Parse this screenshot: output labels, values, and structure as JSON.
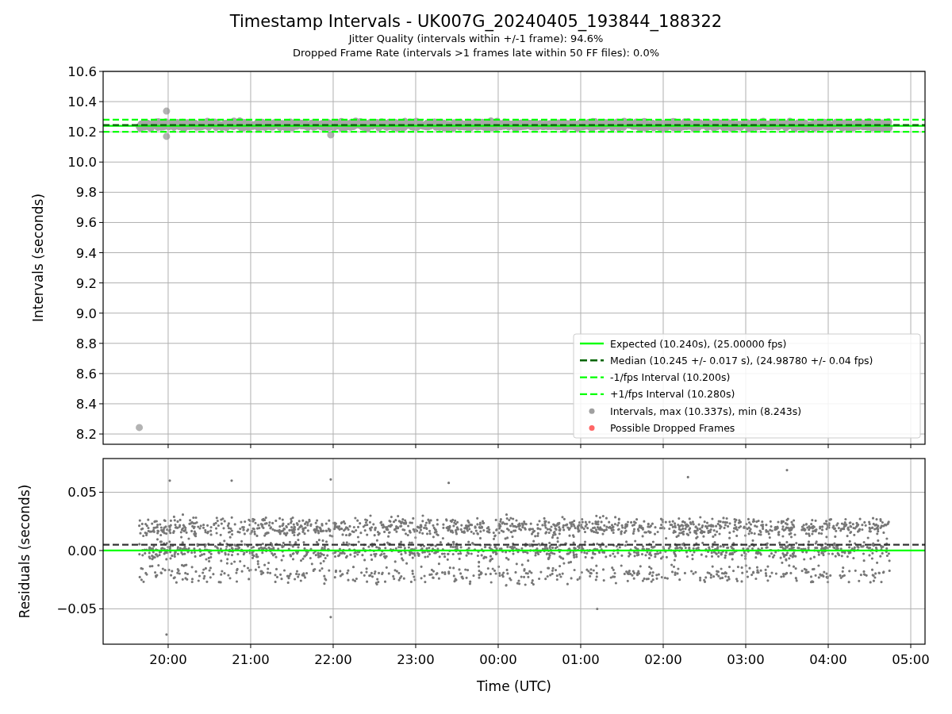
{
  "figure": {
    "title": "Timestamp Intervals - UK007G_20240405_193844_188322",
    "subtitles": [
      "Jitter Quality (intervals within +/-1 frame): 94.6%",
      "Dropped Frame Rate (intervals >1 frames late within 50 FF files): 0.0%"
    ]
  },
  "panels": [
    {
      "legend": [
        {
          "label": "Expected (10.240s), (25.00000 fps)",
          "color": "#00ff00",
          "kind": "line"
        },
        {
          "label": "Median (10.245 +/- 0.017 s), (24.98780 +/- 0.04 fps)",
          "color": "#006400",
          "kind": "dashed"
        },
        {
          "label": "-1/fps Interval (10.200s)",
          "color": "#00ff00",
          "kind": "dashed"
        },
        {
          "label": "+1/fps Interval (10.280s)",
          "color": "#00ff00",
          "kind": "dashed"
        },
        {
          "label": "Intervals, max (10.337s), min (8.243s)",
          "color": "#a0a0a0",
          "kind": "dot"
        },
        {
          "label": "Possible Dropped Frames",
          "color": "#ff6666",
          "kind": "dot"
        }
      ],
      "chart_data": {
        "type": "scatter",
        "ylabel": "Intervals (seconds)",
        "grid": true,
        "xlim": [
          "2024-04-05T19:12:43",
          "2024-04-06T05:10:23"
        ],
        "ylim": [
          8.132,
          10.6
        ],
        "yticks": [
          {
            "value": 8.2,
            "label": "8.2"
          },
          {
            "value": 8.4,
            "label": "8.4"
          },
          {
            "value": 8.6,
            "label": "8.6"
          },
          {
            "value": 8.8,
            "label": "8.8"
          },
          {
            "value": 9.0,
            "label": "9.0"
          },
          {
            "value": 9.2,
            "label": "9.2"
          },
          {
            "value": 9.4,
            "label": "9.4"
          },
          {
            "value": 9.6,
            "label": "9.6"
          },
          {
            "value": 9.8,
            "label": "9.8"
          },
          {
            "value": 10.0,
            "label": "10.0"
          },
          {
            "value": 10.2,
            "label": "10.2"
          },
          {
            "value": 10.4,
            "label": "10.4"
          },
          {
            "value": 10.6,
            "label": "10.6"
          }
        ],
        "ref_lines": [
          {
            "axis": "y",
            "value": 10.24,
            "color": "#00ff00",
            "line_style": "solid"
          },
          {
            "axis": "y",
            "value": 10.245,
            "color": "#006400",
            "line_style": "dashed"
          },
          {
            "axis": "y",
            "value": 10.2,
            "color": "#00ff00",
            "line_style": "dashed"
          },
          {
            "axis": "y",
            "value": 10.28,
            "color": "#00ff00",
            "line_style": "dashed"
          }
        ],
        "series": [
          {
            "color": "#808080",
            "x": [
              "2024-04-05T19:39:00",
              "2024-04-05T19:58:48",
              "2024-04-05T19:58:48",
              "2024-04-05T21:58:12"
            ],
            "values": [
              8.243,
              10.337,
              10.17,
              10.18
            ]
          }
        ]
      }
    },
    {
      "chart_data": {
        "type": "scatter",
        "ylabel": "Residuals (seconds)",
        "xlabel": "Time (UTC)",
        "grid": true,
        "xlim": [
          "2024-04-05T19:12:43",
          "2024-04-06T05:10:23"
        ],
        "ylim": [
          -0.0803,
          0.0789
        ],
        "yticks": [
          {
            "value": -0.05,
            "label": "−0.05"
          },
          {
            "value": 0.0,
            "label": "0.00"
          },
          {
            "value": 0.05,
            "label": "0.05"
          }
        ],
        "xticks": [
          {
            "value": "2024-04-05T20:00:00",
            "label": "20:00"
          },
          {
            "value": "2024-04-05T21:00:00",
            "label": "21:00"
          },
          {
            "value": "2024-04-05T22:00:00",
            "label": "22:00"
          },
          {
            "value": "2024-04-05T23:00:00",
            "label": "23:00"
          },
          {
            "value": "2024-04-06T00:00:00",
            "label": "00:00"
          },
          {
            "value": "2024-04-06T01:00:00",
            "label": "01:00"
          },
          {
            "value": "2024-04-06T02:00:00",
            "label": "02:00"
          },
          {
            "value": "2024-04-06T03:00:00",
            "label": "03:00"
          },
          {
            "value": "2024-04-06T04:00:00",
            "label": "04:00"
          },
          {
            "value": "2024-04-06T05:00:00",
            "label": "05:00"
          }
        ],
        "ref_lines": [
          {
            "axis": "y",
            "value": 0,
            "color": "#00ff00",
            "line_style": "solid"
          },
          {
            "axis": "y",
            "value": 0.005,
            "color": "#333333",
            "line_style": "dashed"
          }
        ],
        "series": [
          {
            "color": "#777777",
            "x": [
              "2024-04-05T19:58:48",
              "2024-04-05T20:01:12",
              "2024-04-05T20:46:12",
              "2024-04-05T21:58:12",
              "2024-04-05T21:58:12",
              "2024-04-05T23:24:00",
              "2024-04-06T01:12:00",
              "2024-04-06T02:18:00",
              "2024-04-06T03:30:00"
            ],
            "values": [
              -0.072,
              0.06,
              0.06,
              0.061,
              -0.057,
              0.058,
              -0.05,
              0.063,
              0.069
            ]
          }
        ]
      }
    }
  ]
}
